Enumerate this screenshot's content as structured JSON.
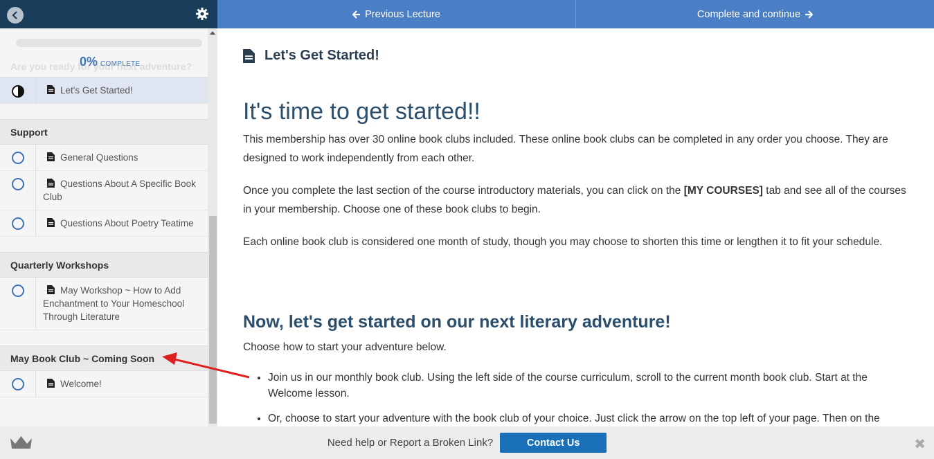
{
  "sidebar": {
    "progress": {
      "percent": "0%",
      "label": "COMPLETE",
      "faded_text": "Are you ready for your next adventure?"
    },
    "active_item": {
      "label": "Let's Get Started!"
    },
    "sections": [
      {
        "title": "Support",
        "items": [
          {
            "label": "General Questions"
          },
          {
            "label": "Questions About A Specific Book Club"
          },
          {
            "label": "Questions About Poetry Teatime"
          }
        ]
      },
      {
        "title": "Quarterly Workshops",
        "items": [
          {
            "label": "May Workshop ~ How to Add Enchantment to Your Homeschool Through Literature"
          }
        ]
      },
      {
        "title": "May Book Club ~ Coming Soon",
        "items": [
          {
            "label": "Welcome!"
          }
        ]
      }
    ]
  },
  "topnav": {
    "prev_label": "Previous Lecture",
    "next_label": "Complete and continue"
  },
  "content": {
    "lesson_title": "Let's Get Started!",
    "heading": "It's time to get started!!",
    "p1": "This membership has over 30 online book clubs included. These online book clubs can be completed in any order you choose. They are designed to work independently from each other.",
    "p2_before": "Once you complete the last section of the course introductory materials, you can click on the ",
    "p2_bold": "[MY COURSES]",
    "p2_after": " tab and see all of the courses in your membership. Choose one of these book clubs to begin.",
    "p3": "Each online book club is considered one month of study, though you may choose to shorten this time or lengthen it to fit your schedule.",
    "subheading": "Now, let's get started on our next literary adventure!",
    "p4": "Choose how to start your adventure below.",
    "bullets": [
      "Join us in our monthly book club. Using the left side of the course curriculum, scroll to the current month book club. Start at the Welcome lesson.",
      "Or, choose to start your adventure with the book club of your choice. Just click the arrow on the top left of your page. Then on the"
    ]
  },
  "footer": {
    "help_text": "Need help or Report a Broken Link?",
    "contact_label": "Contact Us",
    "close_label": "✖"
  },
  "colors": {
    "sidebar_header": "#1b3d5c",
    "topnav": "#4a7fc6",
    "accent": "#3f73b8",
    "contact_button": "#1a70b8",
    "annotation_arrow": "#e02020"
  },
  "icons": [
    "back-arrow-icon",
    "gear-icon",
    "half-circle-icon",
    "document-icon",
    "arrow-left-icon",
    "arrow-right-icon",
    "crown-icon",
    "close-icon"
  ]
}
